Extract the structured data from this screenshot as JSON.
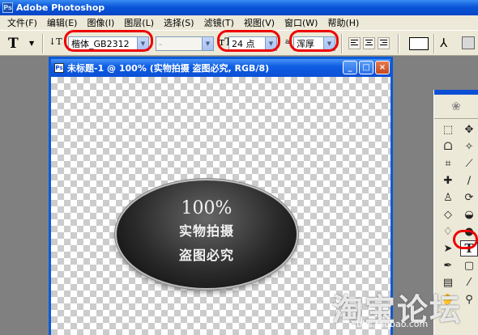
{
  "app": {
    "title": "Adobe Photoshop",
    "logo": "Ps"
  },
  "menu": [
    "文件(F)",
    "编辑(E)",
    "图像(I)",
    "图层(L)",
    "选择(S)",
    "滤镜(T)",
    "视图(V)",
    "窗口(W)",
    "帮助(H)"
  ],
  "options": {
    "font_family": "楷体_GB2312",
    "font_style": "-",
    "font_size": "24 点",
    "antialias": "浑厚"
  },
  "document": {
    "title": "未标题-1 @ 100% (实物拍摄 盗图必究, RGB/8)",
    "stamp": {
      "line1": "100%",
      "line2": "实物拍摄",
      "line3": "盗图必究"
    }
  },
  "watermark": {
    "chars": "淘宝论坛",
    "url": "bbs.taobao.com"
  },
  "colors": {
    "titlebar": "#0a55d8",
    "highlight": "#e00000",
    "chrome": "#ece9d8"
  },
  "icons": [
    "type-tool-icon",
    "marquee-icon",
    "move-icon",
    "lasso-icon",
    "magic-wand-icon",
    "crop-icon",
    "slice-icon",
    "healing-icon",
    "brush-icon",
    "stamp-icon",
    "history-brush-icon",
    "eraser-icon",
    "paint-bucket-icon",
    "blur-icon",
    "dodge-icon",
    "path-select-icon",
    "pen-icon",
    "shape-icon",
    "notes-icon",
    "eyedropper-icon",
    "hand-icon",
    "zoom-icon"
  ]
}
